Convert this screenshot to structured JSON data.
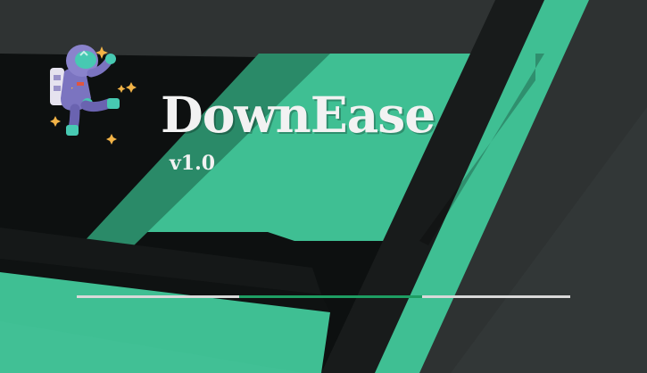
{
  "app": {
    "title": "DownEase",
    "version": "v1.0"
  },
  "progress": {
    "start_fraction": 0.33,
    "end_fraction": 0.7
  },
  "colors": {
    "accent": "#45bf96",
    "accent_dark": "#2f7f63",
    "dark": "#151818",
    "charcoal": "#2c3131",
    "progress_fill": "#1e9e63",
    "progress_track": "#d9d9d9",
    "title_text": "#f2f2f2"
  },
  "icons": {
    "mascot": "astronaut-icon",
    "sparkles": "sparkle-icon"
  }
}
